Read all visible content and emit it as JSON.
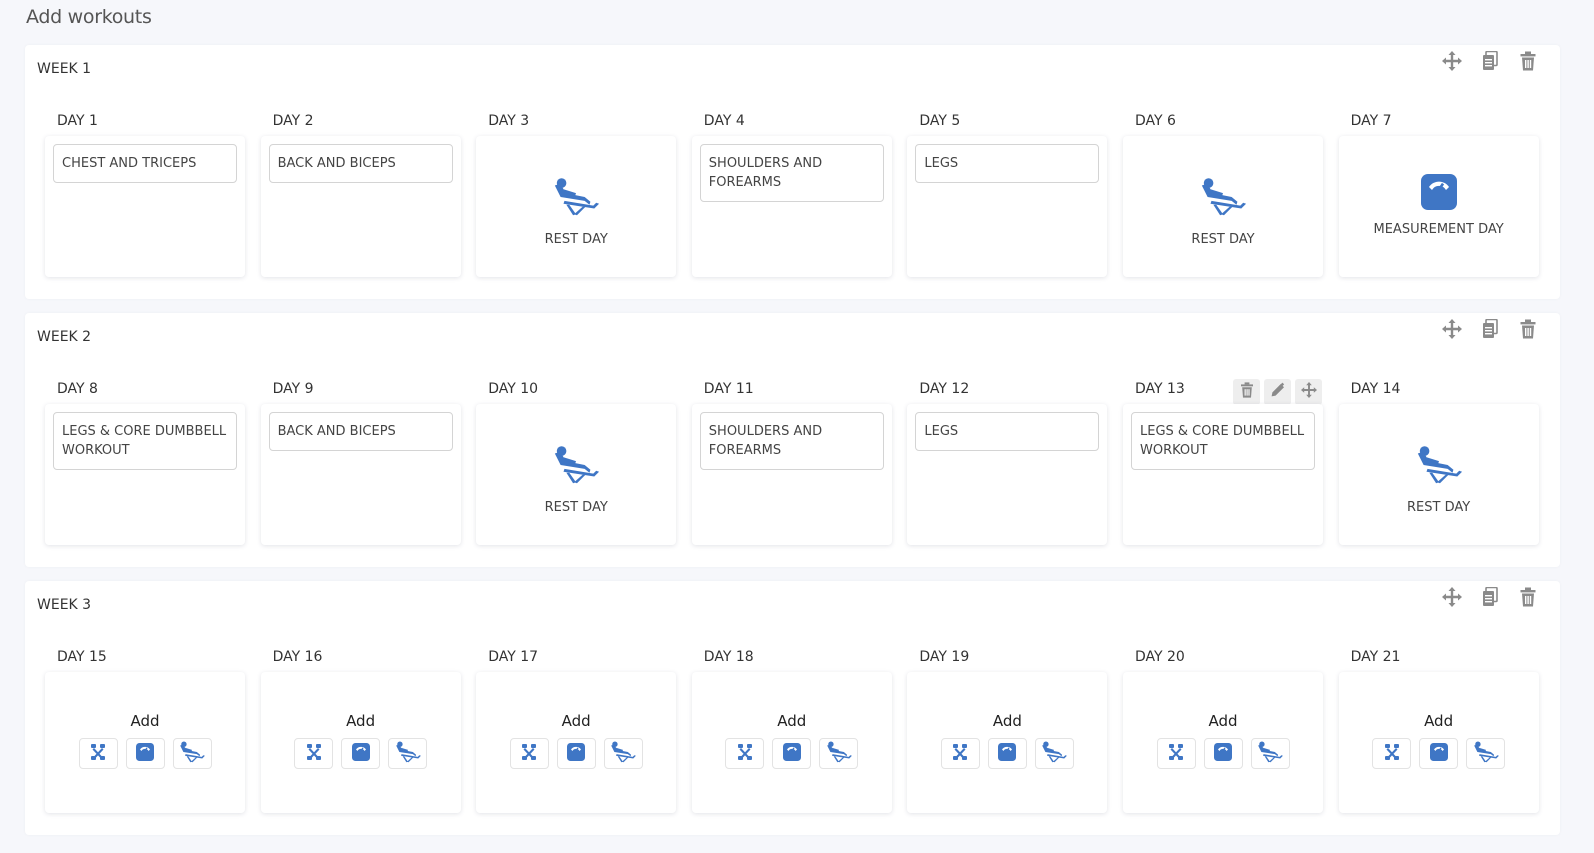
{
  "page": {
    "title": "Add workouts"
  },
  "colors": {
    "accent": "#3f76c5",
    "icon_gray": "#8a8a8a"
  },
  "icons": {
    "week_actions": [
      "move-icon",
      "copy-icon",
      "trash-icon"
    ],
    "day_hover_actions": [
      "trash-icon",
      "pencil-icon",
      "move-icon"
    ],
    "add_options": [
      "dumbbell-icon",
      "scale-icon",
      "rest-chair-icon"
    ]
  },
  "weeks": [
    {
      "title": "WEEK 1",
      "days": [
        {
          "label": "DAY 1",
          "type": "workout",
          "text": "CHEST AND TRICEPS"
        },
        {
          "label": "DAY 2",
          "type": "workout",
          "text": "BACK AND BICEPS"
        },
        {
          "label": "DAY 3",
          "type": "rest",
          "text": "REST DAY"
        },
        {
          "label": "DAY 4",
          "type": "workout",
          "text": "SHOULDERS AND FOREARMS"
        },
        {
          "label": "DAY 5",
          "type": "workout",
          "text": "LEGS"
        },
        {
          "label": "DAY 6",
          "type": "rest",
          "text": "REST DAY"
        },
        {
          "label": "DAY 7",
          "type": "measurement",
          "text": "MEASUREMENT DAY"
        }
      ]
    },
    {
      "title": "WEEK 2",
      "days": [
        {
          "label": "DAY 8",
          "type": "workout",
          "text": "LEGS & CORE DUMBBELL WORKOUT"
        },
        {
          "label": "DAY 9",
          "type": "workout",
          "text": "BACK AND BICEPS"
        },
        {
          "label": "DAY 10",
          "type": "rest",
          "text": "REST DAY"
        },
        {
          "label": "DAY 11",
          "type": "workout",
          "text": "SHOULDERS AND FOREARMS"
        },
        {
          "label": "DAY 12",
          "type": "workout",
          "text": "LEGS"
        },
        {
          "label": "DAY 13",
          "type": "workout",
          "text": "LEGS & CORE DUMBBELL WORKOUT",
          "hovered": true
        },
        {
          "label": "DAY 14",
          "type": "rest",
          "text": "REST DAY"
        }
      ]
    },
    {
      "title": "WEEK 3",
      "days": [
        {
          "label": "DAY 15",
          "type": "add",
          "text": "Add"
        },
        {
          "label": "DAY 16",
          "type": "add",
          "text": "Add"
        },
        {
          "label": "DAY 17",
          "type": "add",
          "text": "Add"
        },
        {
          "label": "DAY 18",
          "type": "add",
          "text": "Add"
        },
        {
          "label": "DAY 19",
          "type": "add",
          "text": "Add"
        },
        {
          "label": "DAY 20",
          "type": "add",
          "text": "Add"
        },
        {
          "label": "DAY 21",
          "type": "add",
          "text": "Add"
        }
      ]
    }
  ]
}
